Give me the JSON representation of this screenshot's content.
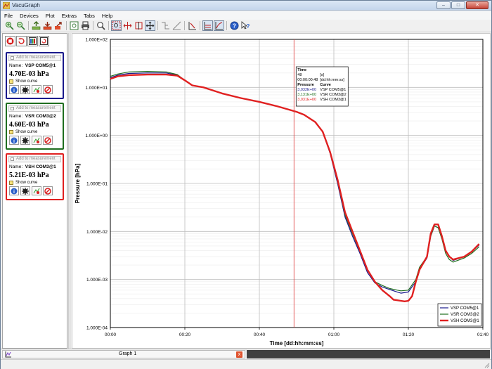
{
  "window": {
    "title": "VacuGraph",
    "minimize": "–",
    "maximize": "□",
    "close": "✕"
  },
  "menu": [
    "File",
    "Devices",
    "Plot",
    "Extras",
    "Tabs",
    "Help"
  ],
  "toolbar_icons": [
    "zoom-in-icon",
    "zoom-out-icon",
    "import-icon",
    "export-icon",
    "send-icon",
    "screenshot-icon",
    "print-icon",
    "magnifier-icon",
    "zoom-rect-icon",
    "zoom-x-icon",
    "zoom-y-icon",
    "pan-icon",
    "curve-a-icon",
    "curve-b-icon",
    "scale-icon",
    "range-icon",
    "range-log-icon",
    "help-icon",
    "context-help-icon"
  ],
  "sidebar": {
    "toolbar_icons": [
      "stop-icon",
      "restart-icon",
      "columns-icon",
      "settings-refresh-icon"
    ],
    "cards": [
      {
        "add_label": "Add to measurement",
        "name_label": "Name:",
        "name": "VSP COM5@1",
        "value": "4.70E-03 hPa",
        "show_label": "Show curve",
        "color": "#1a1a8c"
      },
      {
        "add_label": "Add to measurement",
        "name_label": "Name:",
        "name": "VSR COM3@2",
        "value": "4.60E-03 hPa",
        "show_label": "Show curve",
        "color": "#1f6e1f"
      },
      {
        "add_label": "Add to measurement",
        "name_label": "Name:",
        "name": "VSH COM3@1",
        "value": "5.21E-03 hPa",
        "show_label": "Show curve",
        "color": "#e02020"
      }
    ]
  },
  "tabs": [
    {
      "label": "Graph 1",
      "close": "x"
    }
  ],
  "chart_data": {
    "type": "line",
    "xlabel": "Time [dd:hh:mm:ss]",
    "ylabel": "Pressure [hPa]",
    "x_unit": "minutes",
    "y_scale": "log",
    "xlim": [
      0,
      100
    ],
    "ylim": [
      0.0001,
      100
    ],
    "x_ticks": [
      "00:00",
      "00:20",
      "00:40",
      "01:00",
      "01:20",
      "01:40"
    ],
    "x_tick_values": [
      0,
      20,
      40,
      60,
      80,
      100
    ],
    "y_ticks": [
      "1.000E-04",
      "1.000E-03",
      "1.000E-02",
      "1.000E-01",
      "1.000E+00",
      "1.000E+01",
      "1.000E+02"
    ],
    "y_tick_values": [
      0.0001,
      0.001,
      0.01,
      0.1,
      1,
      10,
      100
    ],
    "grid": true,
    "legend_position": "bottom-right",
    "cursor_x": 49.3,
    "cursor_box": {
      "time_header": "Time",
      "time_seconds": "48",
      "time_unit_s": "[s]",
      "time_value": "00:00:00:48",
      "time_format": "[dd:hh:mm:ss]",
      "pressure_header": "Pressure",
      "curve_header": "Curve",
      "rows": [
        {
          "pressure": "3,032E+00",
          "curve": "VSP COM5@1",
          "color": "#1a1a8c"
        },
        {
          "pressure": "3,131E+00",
          "curve": "VSR COM3@2",
          "color": "#1f6e1f"
        },
        {
          "pressure": "3,031E+00",
          "curve": "VSH COM3@1",
          "color": "#e02020"
        }
      ]
    },
    "series": [
      {
        "name": "VSP COM5@1",
        "color": "#1a1a8c",
        "width": 1.2,
        "x": [
          0,
          2,
          5,
          10,
          15,
          18,
          20,
          22,
          25,
          30,
          35,
          40,
          45,
          50,
          52,
          55,
          57,
          59,
          61,
          63,
          65,
          67,
          69,
          71,
          73,
          75,
          77,
          78,
          80,
          82,
          83,
          85,
          86,
          87,
          88,
          89,
          90,
          91,
          92,
          95,
          97,
          99
        ],
        "y": [
          16,
          18,
          19.5,
          20,
          20,
          18,
          14,
          11,
          10,
          7.5,
          6,
          5,
          4,
          3.1,
          2.7,
          1.9,
          1.2,
          0.42,
          0.1,
          0.02,
          0.008,
          0.0035,
          0.0014,
          0.00085,
          0.0007,
          0.00062,
          0.00055,
          0.00052,
          0.00055,
          0.0009,
          0.0016,
          0.0028,
          0.008,
          0.013,
          0.012,
          0.008,
          0.004,
          0.003,
          0.0025,
          0.003,
          0.0038,
          0.0052
        ]
      },
      {
        "name": "VSR COM3@2",
        "color": "#1f6e1f",
        "width": 1.2,
        "x": [
          0,
          2,
          5,
          10,
          15,
          18,
          20,
          22,
          25,
          30,
          35,
          40,
          45,
          50,
          52,
          55,
          57,
          59,
          61,
          63,
          65,
          67,
          69,
          71,
          73,
          75,
          77,
          78,
          80,
          82,
          83,
          85,
          86,
          87,
          88,
          89,
          90,
          91,
          92,
          95,
          97,
          99
        ],
        "y": [
          17,
          19,
          21,
          21.5,
          21,
          18.5,
          14,
          11,
          10,
          7.5,
          6,
          5,
          4,
          3.1,
          2.7,
          1.9,
          1.2,
          0.45,
          0.11,
          0.022,
          0.009,
          0.0038,
          0.0016,
          0.0009,
          0.00075,
          0.00065,
          0.0006,
          0.00058,
          0.0006,
          0.001,
          0.0018,
          0.003,
          0.008,
          0.013,
          0.012,
          0.007,
          0.0035,
          0.0026,
          0.0023,
          0.0028,
          0.0035,
          0.0048
        ]
      },
      {
        "name": "VSH COM3@1",
        "color": "#e02020",
        "width": 2.4,
        "x": [
          0,
          2,
          5,
          10,
          15,
          18,
          20,
          22,
          25,
          30,
          35,
          40,
          45,
          50,
          52,
          55,
          57,
          59,
          61,
          63,
          65,
          67,
          69,
          71,
          73,
          75,
          76,
          77,
          78,
          79,
          80,
          81,
          82,
          83,
          85,
          86,
          87,
          88,
          89,
          90,
          91,
          92,
          95,
          97,
          99
        ],
        "y": [
          15,
          17,
          18,
          18.5,
          18.5,
          17.5,
          14,
          11,
          10,
          7.5,
          6,
          5,
          4,
          3.1,
          2.7,
          1.9,
          1.2,
          0.45,
          0.12,
          0.025,
          0.01,
          0.004,
          0.0016,
          0.0009,
          0.0006,
          0.00045,
          0.00038,
          0.00037,
          0.00036,
          0.00035,
          0.00036,
          0.00045,
          0.0009,
          0.0016,
          0.003,
          0.009,
          0.014,
          0.014,
          0.008,
          0.004,
          0.003,
          0.0026,
          0.003,
          0.0038,
          0.0055
        ]
      }
    ]
  }
}
